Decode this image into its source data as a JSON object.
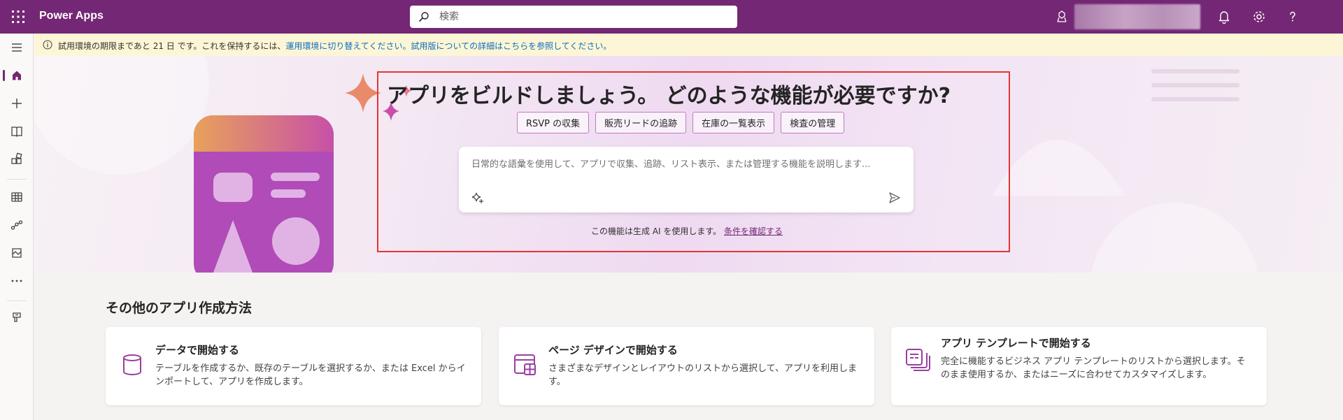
{
  "header": {
    "app_title": "Power Apps",
    "search_placeholder": "検索",
    "brand_color": "#742774"
  },
  "notice": {
    "prefix": "試用環境の期限まであと 21 日 です。これを保持するには、",
    "link1": "運用環境に切り替えてください。",
    "link2": "試用版についての詳細はこちらを参照してください。"
  },
  "hero": {
    "title": "アプリをビルドしましょう。 どのような機能が必要ですか?",
    "chips": [
      "RSVP の収集",
      "販売リードの追跡",
      "在庫の一覧表示",
      "検査の管理"
    ],
    "prompt_placeholder": "日常的な語彙を使用して、アプリで収集、追跡、リスト表示、または管理する機能を説明します...",
    "disclaimer_text": "この機能は生成 AI を使用します。",
    "disclaimer_link": "条件を確認する"
  },
  "other_methods": {
    "title": "その他のアプリ作成方法",
    "cards": [
      {
        "title": "データで開始する",
        "desc": "テーブルを作成するか、既存のテーブルを選択するか、または Excel からインポートして、アプリを作成します。",
        "icon": "database-icon"
      },
      {
        "title": "ページ デザインで開始する",
        "desc": "さまざまなデザインとレイアウトのリストから選択して、アプリを利用します。",
        "icon": "page-design-icon"
      },
      {
        "title": "アプリ テンプレートで開始する",
        "desc": "完全に機能するビジネス アプリ テンプレートのリストから選択します。そのまま使用するか、またはニーズに合わせてカスタマイズします。",
        "icon": "template-icon"
      }
    ]
  }
}
